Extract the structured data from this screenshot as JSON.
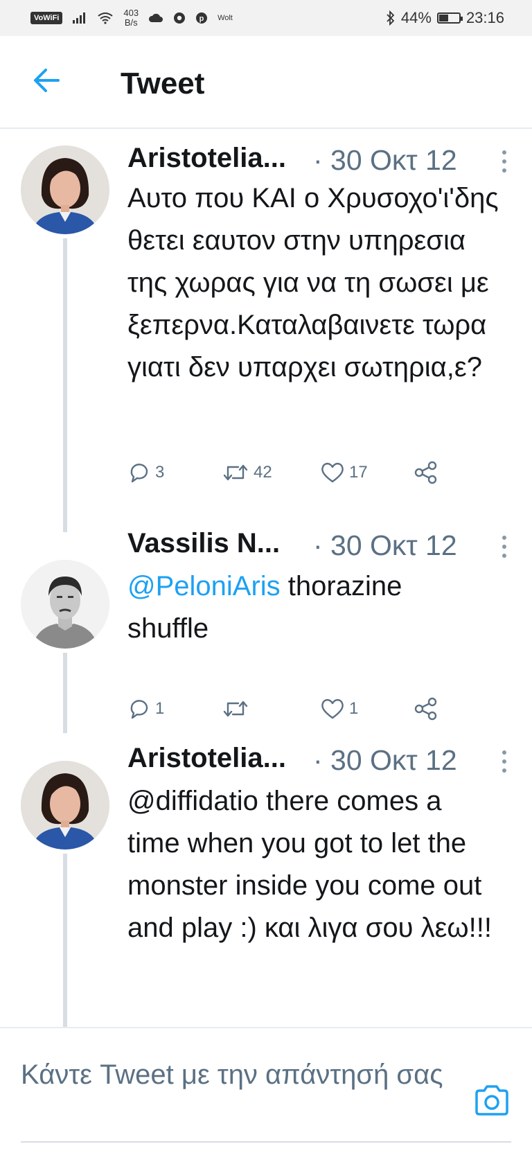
{
  "status_bar": {
    "wifi_chip": "VoWiFi",
    "speed_value": "403",
    "speed_unit": "B/s",
    "app_label": "Wolt",
    "battery": "44%",
    "battery_level": 0.44,
    "time": "23:16"
  },
  "header": {
    "title": "Tweet"
  },
  "tweets": [
    {
      "name": "Aristotelia...",
      "date": "· 30 Οκτ 12",
      "text": "Αυτο που ΚΑΙ ο Χρυσοχο'ι'δης θετει εαυτον στην υπηρεσια της χωρας για να τη σωσει με ξεπερνα.Καταλαβαινετε τωρα γιατι δεν υπαρχει σωτηρια,ε?",
      "replies": "3",
      "retweets": "42",
      "likes": "17"
    },
    {
      "name": "Vassilis N...",
      "date": "· 30 Οκτ 12",
      "mention": "@PeloniAris",
      "text": " thorazine shuffle",
      "replies": "1",
      "retweets": "",
      "likes": "1"
    },
    {
      "name": "Aristotelia...",
      "date": "· 30 Οκτ 12",
      "text": "@diffidatio there comes a time when you got to let the monster inside you come out and play :) και λιγα σου λεω!!!"
    }
  ],
  "reply": {
    "placeholder": "Κάντε Tweet με την απάντησή σας"
  },
  "colors": {
    "accent": "#1da1f2",
    "secondary_text": "#5b7083",
    "divider": "#e6ecf0"
  }
}
